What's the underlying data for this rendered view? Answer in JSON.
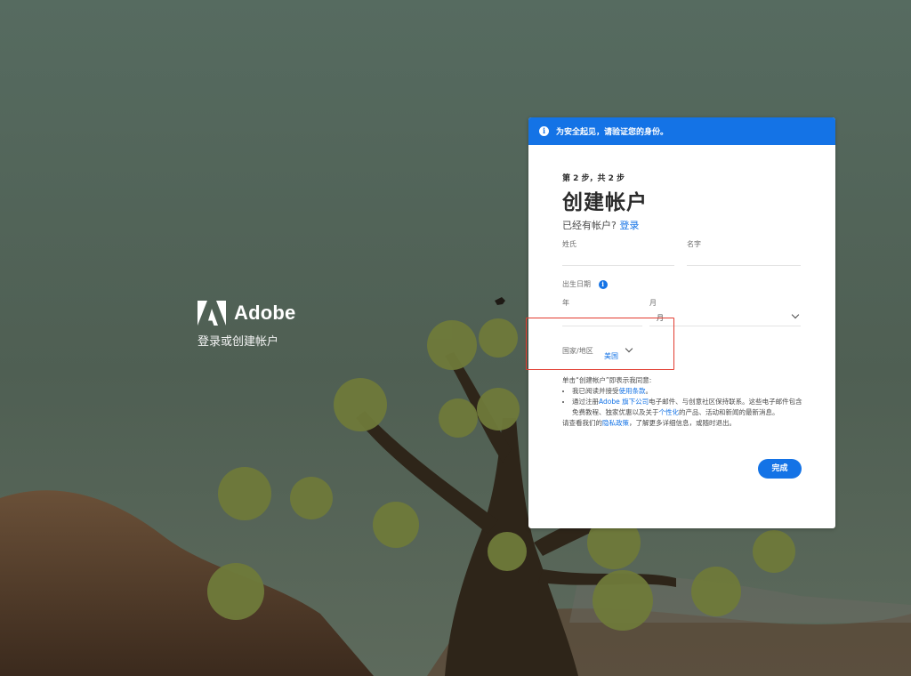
{
  "brand": {
    "name": "Adobe",
    "tagline": "登录或创建帐户"
  },
  "banner": {
    "message": "为安全起见，请验证您的身份。"
  },
  "form": {
    "step": "第 2 步，共 2 步",
    "title": "创建帐户",
    "have_account": "已经有帐户?",
    "sign_in": "登录",
    "last_name_label": "姓氏",
    "first_name_label": "名字",
    "dob_label": "出生日期",
    "year_label": "年",
    "month_label": "月",
    "month_value": "月",
    "country_label": "国家/地区",
    "country_value": "美国"
  },
  "legal": {
    "intro": "单击“创建帐户”即表示我同意:",
    "item1_pre": "我已阅读并接受",
    "item1_link": "使用条款",
    "item1_post": "。",
    "item2_pre": "通过注册",
    "item2_link": "Adobe 旗下公司",
    "item2_mid": "电子邮件、与创意社区保持联系。这些电子邮件包含免费教程、独家优惠以及关于",
    "item2_link2": "个性化",
    "item2_post": "的产品、活动和新闻的最新消息。",
    "outro_pre": "请查看我们的",
    "outro_link": "隐私政策",
    "outro_post": "，了解更多详细信息，或随时退出。"
  },
  "actions": {
    "finish": "完成"
  },
  "colors": {
    "accent": "#1473e6",
    "highlight": "#e23b2f"
  }
}
